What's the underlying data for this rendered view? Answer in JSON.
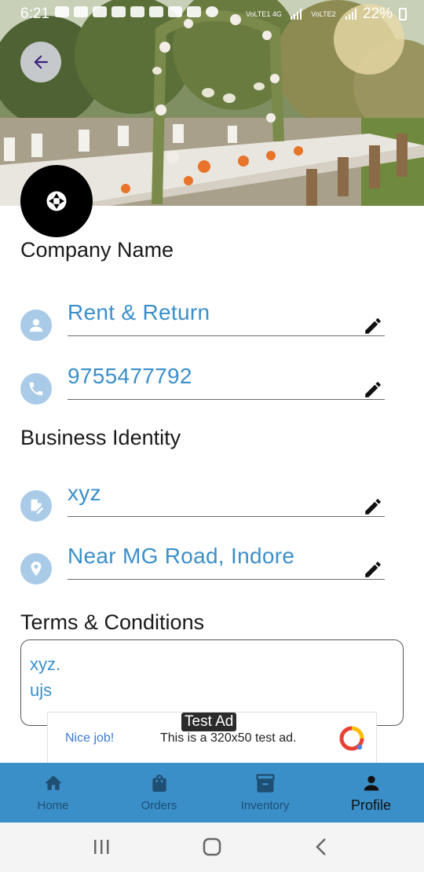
{
  "status_bar": {
    "time": "6:21",
    "network_1": "VoLTE1 4G",
    "network_2": "VoLTE2",
    "battery": "22%"
  },
  "header": {
    "back_icon": "arrow-left-icon",
    "avatar_icon": "camera-shutter-icon"
  },
  "company": {
    "section_title": "Company Name",
    "name": "Rent & Return",
    "phone": "9755477792"
  },
  "business": {
    "section_title": "Business Identity",
    "identity": "xyz",
    "address": "Near MG Road, Indore"
  },
  "terms": {
    "section_title": "Terms & Conditions",
    "text": "xyz.\nujs"
  },
  "ad": {
    "badge": "Test Ad",
    "headline": "Nice job!",
    "description": "This is a 320x50 test ad."
  },
  "bottom_nav": {
    "tabs": [
      {
        "label": "Home",
        "icon": "home-icon"
      },
      {
        "label": "Orders",
        "icon": "shopping-bag-icon"
      },
      {
        "label": "Inventory",
        "icon": "archive-box-icon"
      },
      {
        "label": "Profile",
        "icon": "person-icon",
        "active": true
      }
    ]
  },
  "colors": {
    "accent": "#3b8fc9",
    "icon_bg": "#a9cbe8",
    "nav_bg": "#3b8fc9"
  }
}
